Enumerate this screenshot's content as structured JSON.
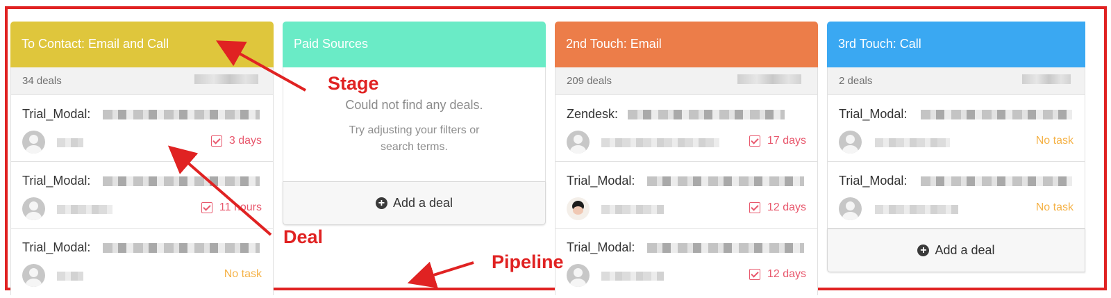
{
  "colors": {
    "frame": "#e02222",
    "stage1": "#dfc63c",
    "stage2": "#6aebc6",
    "stage3": "#ec7d49",
    "stage4": "#3aa8f2",
    "task_overdue": "#e8586d",
    "task_none": "#f5b247"
  },
  "columns": [
    {
      "title": "To Contact: Email and Call",
      "count": "34 deals",
      "deals": [
        {
          "title": "Trial_Modal:",
          "task": "3 days",
          "task_icon": "checkbox-icon"
        },
        {
          "title": "Trial_Modal:",
          "task": "11 hours",
          "task_icon": "checkbox-icon"
        },
        {
          "title": "Trial_Modal:",
          "task": "No task",
          "task_icon": ""
        }
      ]
    },
    {
      "title": "Paid Sources",
      "empty_title": "Could not find any deals.",
      "empty_hint": "Try adjusting your filters or search terms.",
      "add_label": "Add a deal"
    },
    {
      "title": "2nd Touch: Email",
      "count": "209 deals",
      "deals": [
        {
          "title": "Zendesk:",
          "task": "17 days",
          "task_icon": "checkbox-icon"
        },
        {
          "title": "Trial_Modal:",
          "task": "12 days",
          "task_icon": "checkbox-icon"
        },
        {
          "title": "Trial_Modal:",
          "task": "12 days",
          "task_icon": "checkbox-icon"
        }
      ]
    },
    {
      "title": "3rd Touch: Call",
      "count": "2 deals",
      "deals": [
        {
          "title": "Trial_Modal:",
          "task": "No task",
          "task_icon": ""
        },
        {
          "title": "Trial_Modal:",
          "task": "No task",
          "task_icon": ""
        }
      ],
      "add_label": "Add a deal"
    }
  ],
  "annotations": {
    "stage": "Stage",
    "deal": "Deal",
    "pipeline": "Pipeline"
  }
}
